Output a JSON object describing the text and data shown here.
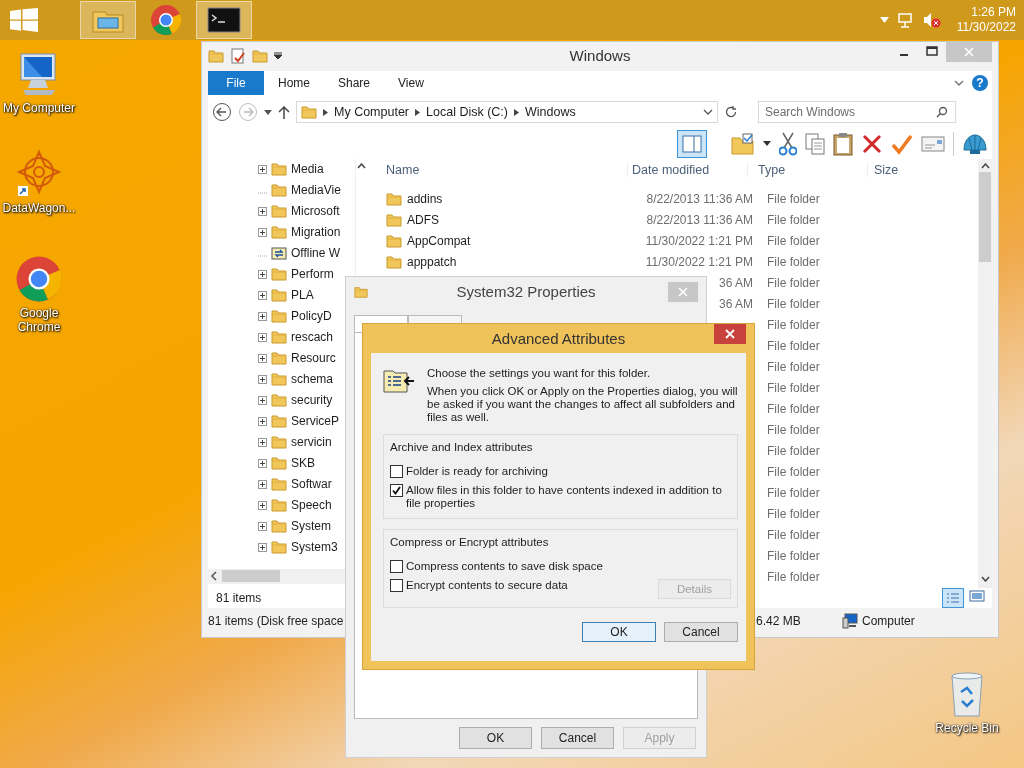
{
  "taskbar": {
    "apps": [
      {
        "kind": "explorer",
        "active": true
      },
      {
        "kind": "chrome",
        "active": false
      },
      {
        "kind": "terminal",
        "active": true
      }
    ],
    "time": "1:26 PM",
    "date": "11/30/2022"
  },
  "desktop_icons": [
    {
      "kind": "computer",
      "label": "My Computer"
    },
    {
      "kind": "mandala",
      "label": "DataWagon..."
    },
    {
      "kind": "chrome",
      "label": "Google Chrome"
    },
    {
      "kind": "recycle",
      "label": "Recycle Bin"
    }
  ],
  "explorer": {
    "title": "Windows",
    "file_tab": "File",
    "help": "?",
    "ribbon_tabs": [
      "Home",
      "Share",
      "View"
    ],
    "breadcrumbs": [
      "My Computer",
      "Local Disk (C:)",
      "Windows"
    ],
    "search": {
      "placeholder": "Search Windows"
    },
    "tree": [
      {
        "label": "Media",
        "expandable": true,
        "kind": "folder"
      },
      {
        "label": "MediaVie",
        "expandable": false,
        "kind": "folder"
      },
      {
        "label": "Microsoft",
        "expandable": true,
        "kind": "folder"
      },
      {
        "label": "Migration",
        "expandable": true,
        "kind": "folder"
      },
      {
        "label": "Offline W",
        "expandable": false,
        "kind": "offline"
      },
      {
        "label": "Perform",
        "expandable": true,
        "kind": "folder"
      },
      {
        "label": "PLA",
        "expandable": true,
        "kind": "folder"
      },
      {
        "label": "PolicyD",
        "expandable": true,
        "kind": "folder"
      },
      {
        "label": "rescach",
        "expandable": true,
        "kind": "folder"
      },
      {
        "label": "Resourc",
        "expandable": true,
        "kind": "folder"
      },
      {
        "label": "schema",
        "expandable": true,
        "kind": "folder"
      },
      {
        "label": "security",
        "expandable": true,
        "kind": "folder"
      },
      {
        "label": "ServiceP",
        "expandable": true,
        "kind": "folder"
      },
      {
        "label": "servicin",
        "expandable": true,
        "kind": "folder"
      },
      {
        "label": "SKB",
        "expandable": true,
        "kind": "folder"
      },
      {
        "label": "Softwar",
        "expandable": true,
        "kind": "folder"
      },
      {
        "label": "Speech",
        "expandable": true,
        "kind": "folder"
      },
      {
        "label": "System",
        "expandable": true,
        "kind": "folder"
      },
      {
        "label": "System3",
        "expandable": true,
        "kind": "folder"
      }
    ],
    "columns": [
      "Name",
      "Date modified",
      "Type",
      "Size"
    ],
    "rows": [
      {
        "name": "addins",
        "date": "8/22/2013 11:36 AM",
        "type": "File folder"
      },
      {
        "name": "ADFS",
        "date": "8/22/2013 11:36 AM",
        "type": "File folder"
      },
      {
        "name": "AppCompat",
        "date": "11/30/2022 1:21 PM",
        "type": "File folder"
      },
      {
        "name": "apppatch",
        "date": "11/30/2022 1:21 PM",
        "type": "File folder"
      },
      {
        "date": "36 AM",
        "type": "File folder"
      },
      {
        "date": "36 AM",
        "type": "File folder"
      },
      {
        "type": "File folder"
      },
      {
        "type": "File folder"
      },
      {
        "type": "File folder"
      },
      {
        "type": "File folder"
      },
      {
        "type": "File folder"
      },
      {
        "type": "File folder"
      },
      {
        "type": "File folder"
      },
      {
        "type": "File folder"
      },
      {
        "type": "File folder"
      },
      {
        "type": "File folder"
      },
      {
        "type": "File folder"
      },
      {
        "type": "File folder"
      },
      {
        "type": "File folder"
      }
    ],
    "item_count": "81 items",
    "status": {
      "details": "81 items (Disk free space",
      "size": "6.42 MB",
      "location": "Computer"
    }
  },
  "properties": {
    "title": "System32 Properties",
    "buttons": [
      {
        "label": "OK",
        "disabled": false
      },
      {
        "label": "Cancel",
        "disabled": false
      },
      {
        "label": "Apply",
        "disabled": true
      }
    ]
  },
  "advanced": {
    "title": "Advanced Attributes",
    "intro": "Choose the settings you want for this folder.",
    "note": "When you click OK or Apply on the Properties dialog, you will be asked if you want the changes to affect all subfolders and files as well.",
    "groups": [
      {
        "title": "Archive and Index attributes",
        "options": [
          {
            "label": "Folder is ready for archiving",
            "checked": false
          },
          {
            "label": "Allow files in this folder to have contents indexed in addition to file properties",
            "checked": true
          }
        ]
      },
      {
        "title": "Compress or Encrypt attributes",
        "options": [
          {
            "label": "Compress contents to save disk space",
            "checked": false
          },
          {
            "label": "Encrypt contents to secure data",
            "checked": false
          }
        ],
        "button": {
          "label": "Details",
          "disabled": true
        }
      }
    ],
    "buttons": [
      {
        "label": "OK",
        "default": true
      },
      {
        "label": "Cancel",
        "default": false
      }
    ]
  }
}
